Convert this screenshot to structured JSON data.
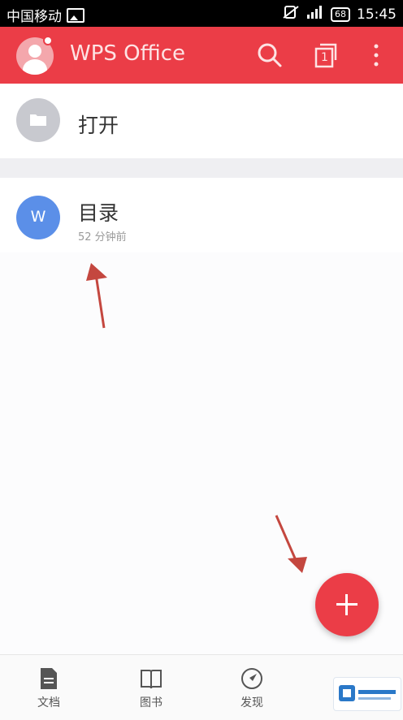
{
  "status_bar": {
    "carrier": "中国移动",
    "time": "15:45",
    "battery": "68"
  },
  "app_bar": {
    "title": "WPS Office",
    "tab_count": "1"
  },
  "open_row": {
    "label": "打开"
  },
  "recent": [
    {
      "title": "目录",
      "subtitle": "52 分钟前",
      "icon_letter": "W"
    }
  ],
  "bottom_nav": [
    {
      "label": "文档",
      "icon": "document-icon"
    },
    {
      "label": "图书",
      "icon": "book-icon"
    },
    {
      "label": "发现",
      "icon": "compass-icon"
    }
  ],
  "colors": {
    "brand": "#eb3d47",
    "doc_icon_blue": "#5b8fe8",
    "folder_gray": "#c8c9cf"
  }
}
